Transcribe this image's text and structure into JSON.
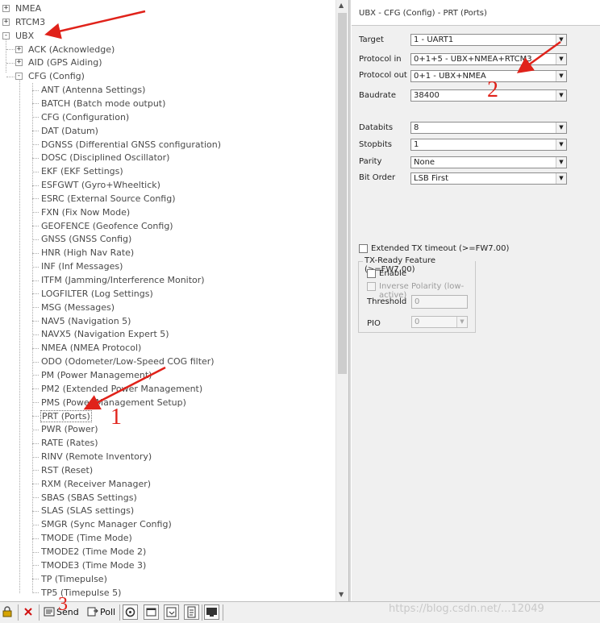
{
  "tree": {
    "items": [
      {
        "label": "NMEA",
        "level": 0,
        "expander": "+"
      },
      {
        "label": "RTCM3",
        "level": 0,
        "expander": "+"
      },
      {
        "label": "UBX",
        "level": 0,
        "expander": "-"
      },
      {
        "label": "ACK (Acknowledge)",
        "level": 1,
        "expander": "+"
      },
      {
        "label": "AID (GPS Aiding)",
        "level": 1,
        "expander": "+"
      },
      {
        "label": "CFG (Config)",
        "level": 1,
        "expander": "-"
      },
      {
        "label": "ANT (Antenna Settings)",
        "level": 2
      },
      {
        "label": "BATCH (Batch mode output)",
        "level": 2
      },
      {
        "label": "CFG (Configuration)",
        "level": 2
      },
      {
        "label": "DAT (Datum)",
        "level": 2
      },
      {
        "label": "DGNSS (Differential GNSS configuration)",
        "level": 2
      },
      {
        "label": "DOSC (Disciplined Oscillator)",
        "level": 2
      },
      {
        "label": "EKF (EKF Settings)",
        "level": 2
      },
      {
        "label": "ESFGWT (Gyro+Wheeltick)",
        "level": 2
      },
      {
        "label": "ESRC (External Source Config)",
        "level": 2
      },
      {
        "label": "FXN (Fix Now Mode)",
        "level": 2
      },
      {
        "label": "GEOFENCE (Geofence Config)",
        "level": 2
      },
      {
        "label": "GNSS (GNSS Config)",
        "level": 2
      },
      {
        "label": "HNR (High Nav Rate)",
        "level": 2
      },
      {
        "label": "INF (Inf Messages)",
        "level": 2
      },
      {
        "label": "ITFM (Jamming/Interference Monitor)",
        "level": 2
      },
      {
        "label": "LOGFILTER (Log Settings)",
        "level": 2
      },
      {
        "label": "MSG (Messages)",
        "level": 2
      },
      {
        "label": "NAV5 (Navigation 5)",
        "level": 2
      },
      {
        "label": "NAVX5 (Navigation Expert 5)",
        "level": 2
      },
      {
        "label": "NMEA (NMEA Protocol)",
        "level": 2
      },
      {
        "label": "ODO (Odometer/Low-Speed COG filter)",
        "level": 2
      },
      {
        "label": "PM (Power Management)",
        "level": 2
      },
      {
        "label": "PM2 (Extended Power Management)",
        "level": 2
      },
      {
        "label": "PMS (Power Management Setup)",
        "level": 2
      },
      {
        "label": "PRT (Ports)",
        "level": 2,
        "selected": true
      },
      {
        "label": "PWR (Power)",
        "level": 2
      },
      {
        "label": "RATE (Rates)",
        "level": 2
      },
      {
        "label": "RINV (Remote Inventory)",
        "level": 2
      },
      {
        "label": "RST (Reset)",
        "level": 2
      },
      {
        "label": "RXM (Receiver Manager)",
        "level": 2
      },
      {
        "label": "SBAS (SBAS Settings)",
        "level": 2
      },
      {
        "label": "SLAS (SLAS settings)",
        "level": 2
      },
      {
        "label": "SMGR (Sync Manager Config)",
        "level": 2
      },
      {
        "label": "TMODE (Time Mode)",
        "level": 2
      },
      {
        "label": "TMODE2 (Time Mode 2)",
        "level": 2
      },
      {
        "label": "TMODE3 (Time Mode 3)",
        "level": 2
      },
      {
        "label": "TP (Timepulse)",
        "level": 2
      },
      {
        "label": "TP5 (Timepulse 5)",
        "level": 2
      }
    ]
  },
  "config": {
    "header": "UBX - CFG (Config) - PRT (Ports)",
    "target": {
      "label": "Target",
      "value": "1 - UART1"
    },
    "protocol_in": {
      "label": "Protocol in",
      "value": "0+1+5 - UBX+NMEA+RTCM3"
    },
    "protocol_out": {
      "label": "Protocol out",
      "value": "0+1 - UBX+NMEA"
    },
    "baudrate": {
      "label": "Baudrate",
      "value": "38400"
    },
    "databits": {
      "label": "Databits",
      "value": "8"
    },
    "stopbits": {
      "label": "Stopbits",
      "value": "1"
    },
    "parity": {
      "label": "Parity",
      "value": "None"
    },
    "bit_order": {
      "label": "Bit Order",
      "value": "LSB First"
    },
    "extended_tx_timeout": {
      "label": "Extended TX timeout (>=FW7.00)",
      "checked": false
    },
    "txready": {
      "legend": "TX-Ready Feature (>=FW7.00)",
      "enable": {
        "label": "Enable",
        "checked": false
      },
      "inverse_polarity": {
        "label": "Inverse Polarity (low-active)",
        "checked": false
      },
      "threshold": {
        "label": "Threshold",
        "value": "0"
      },
      "pio": {
        "label": "PIO",
        "value": "0"
      }
    }
  },
  "toolbar": {
    "send_label": "Send",
    "poll_label": "Poll"
  },
  "annotations": {
    "num1": "1",
    "num2": "2",
    "num3": "3",
    "color": "#e0221a"
  },
  "watermark": "https://blog.csdn.net/...12049"
}
